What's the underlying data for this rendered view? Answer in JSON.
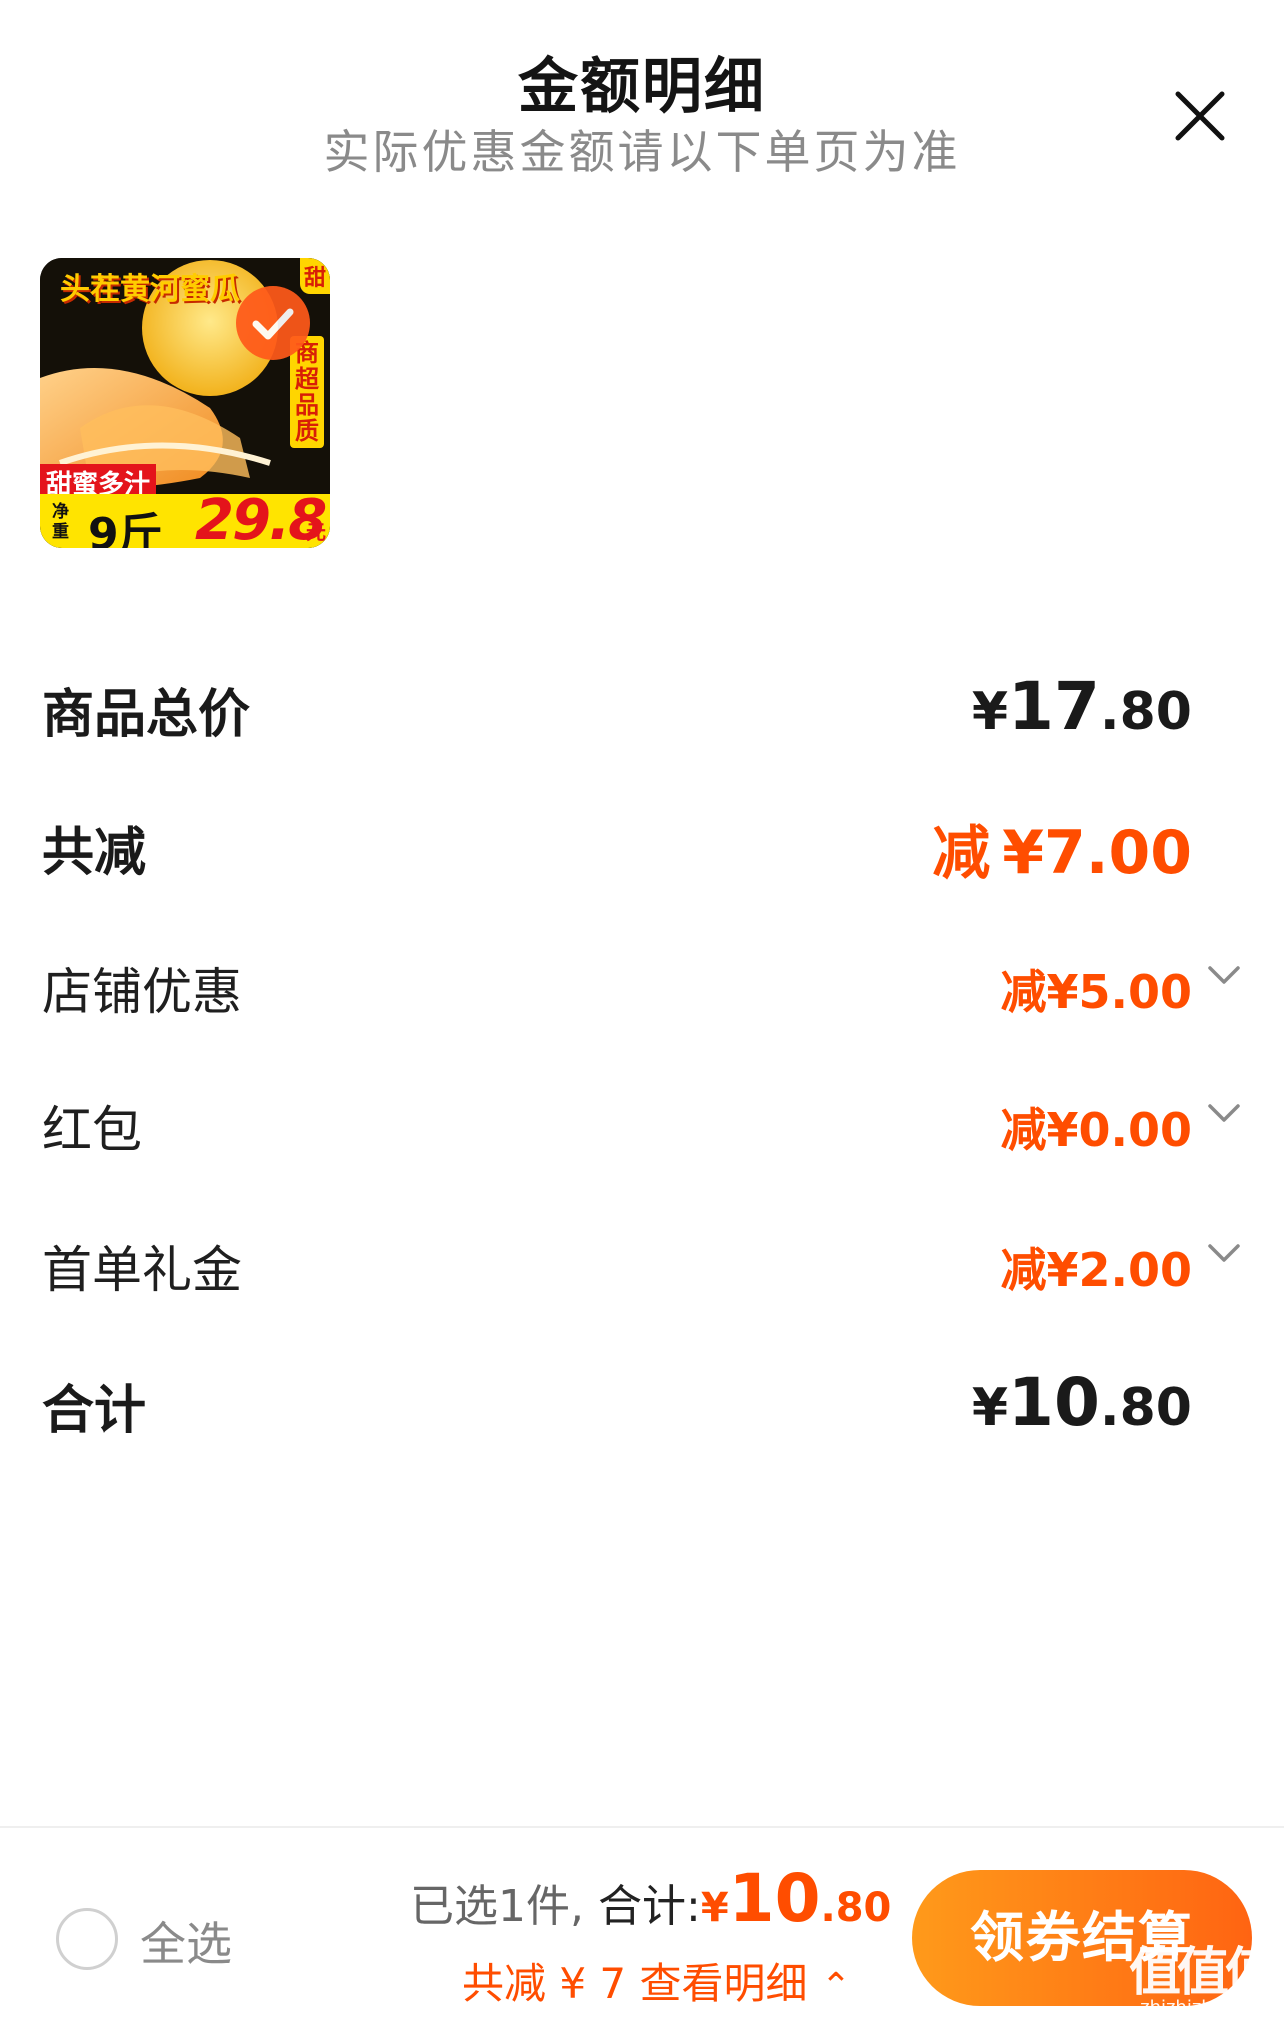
{
  "header": {
    "title": "金额明细",
    "subtitle": "实际优惠金额请以下单页为准",
    "close_icon": "close-icon"
  },
  "product": {
    "thumbnail": {
      "title": "头茬黄河蜜瓜",
      "side_text": "商超品质",
      "corner_tag": "甜",
      "tag": "甜蜜多汁",
      "weight_prefix": "净重",
      "weight": "9斤",
      "price": "29.8",
      "price_suffix": "元"
    },
    "selected": true,
    "check_icon": "check-icon"
  },
  "breakdown": {
    "total_price": {
      "label": "商品总价",
      "currency": "¥",
      "integer": "17",
      "decimal": ".80"
    },
    "total_reduction": {
      "label": "共减",
      "prefix": "减",
      "amount": "¥7.00"
    },
    "items": [
      {
        "label": "店铺优惠",
        "amount": "减¥5.00",
        "icon": "chevron-down-icon"
      },
      {
        "label": "红包",
        "amount": "减¥0.00",
        "icon": "chevron-down-icon"
      },
      {
        "label": "首单礼金",
        "amount": "减¥2.00",
        "icon": "chevron-down-icon"
      }
    ],
    "sum": {
      "label": "合计",
      "currency": "¥",
      "integer": "10",
      "decimal": ".80"
    }
  },
  "footer": {
    "select_all": "全选",
    "selected_count": "已选1件,",
    "total_label": "合计:",
    "total_currency": "¥",
    "total_integer": "10",
    "total_decimal": ".80",
    "reduction_link": "共减 ¥ 7 查看明细",
    "caret_icon": "caret-up-icon",
    "checkout_button": "领券结算",
    "watermark": {
      "text": "值值值",
      "url": "zhizhizhi.com"
    }
  },
  "colors": {
    "accent": "#ff4d00",
    "button_start": "#ff9a1a",
    "button_end": "#ff6412",
    "subtitle": "#8a8a8a"
  }
}
